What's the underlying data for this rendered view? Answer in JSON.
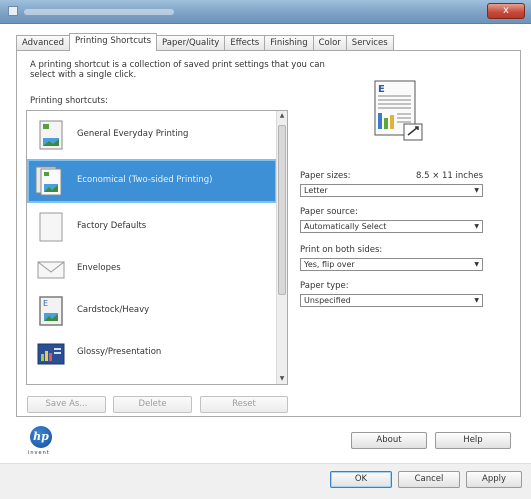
{
  "window": {
    "close_glyph": "x"
  },
  "tabs": [
    {
      "label": "Advanced",
      "active": false
    },
    {
      "label": "Printing Shortcuts",
      "active": true
    },
    {
      "label": "Paper/Quality",
      "active": false
    },
    {
      "label": "Effects",
      "active": false
    },
    {
      "label": "Finishing",
      "active": false
    },
    {
      "label": "Color",
      "active": false
    },
    {
      "label": "Services",
      "active": false
    }
  ],
  "shortcuts": {
    "description": "A printing shortcut is a collection of saved print settings that you can select with a single click.",
    "list_label": "Printing shortcuts:",
    "items": [
      {
        "label": "General Everyday Printing",
        "icon": "general-printing-icon"
      },
      {
        "label": "Economical (Two-sided Printing)",
        "icon": "two-sided-printing-icon",
        "selected": true
      },
      {
        "label": "Factory Defaults",
        "icon": "factory-defaults-icon"
      },
      {
        "label": "Envelopes",
        "icon": "envelope-icon"
      },
      {
        "label": "Cardstock/Heavy",
        "icon": "cardstock-icon"
      },
      {
        "label": "Glossy/Presentation",
        "icon": "glossy-presentation-icon"
      }
    ],
    "buttons": {
      "save_as": "Save As...",
      "delete": "Delete",
      "reset": "Reset"
    }
  },
  "settings": {
    "paper_size_label": "Paper sizes:",
    "paper_size_value": "8.5 × 11 inches",
    "paper_size_select": "Letter",
    "paper_source_label": "Paper source:",
    "paper_source_select": "Automatically Select",
    "two_sided_label": "Print on both sides:",
    "two_sided_select": "Yes, flip over",
    "paper_type_label": "Paper type:",
    "paper_type_select": "Unspecified"
  },
  "brand": {
    "logo_text": "hp",
    "caption": "invent"
  },
  "footer_buttons": {
    "about": "About",
    "help": "Help",
    "ok": "OK",
    "cancel": "Cancel",
    "apply": "Apply"
  },
  "colors": {
    "selection": "#3d8fd6",
    "selection_border": "#7fc0f2",
    "titlebar": "#7fa3c6",
    "close_button": "#c5493a"
  }
}
